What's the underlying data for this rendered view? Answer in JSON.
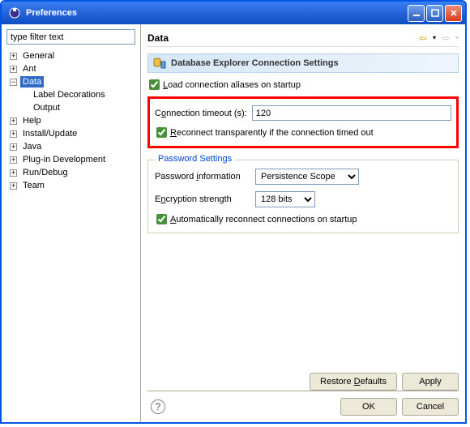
{
  "window": {
    "title": "Preferences"
  },
  "sidebar": {
    "filter_placeholder": "type filter text",
    "items": [
      {
        "label": "General",
        "expandable": true,
        "expanded": false
      },
      {
        "label": "Ant",
        "expandable": true,
        "expanded": false
      },
      {
        "label": "Data",
        "expandable": true,
        "expanded": true,
        "selected": true,
        "children": [
          {
            "label": "Label Decorations"
          },
          {
            "label": "Output"
          }
        ]
      },
      {
        "label": "Help",
        "expandable": true,
        "expanded": false
      },
      {
        "label": "Install/Update",
        "expandable": true,
        "expanded": false
      },
      {
        "label": "Java",
        "expandable": true,
        "expanded": false
      },
      {
        "label": "Plug-in Development",
        "expandable": true,
        "expanded": false
      },
      {
        "label": "Run/Debug",
        "expandable": true,
        "expanded": false
      },
      {
        "label": "Team",
        "expandable": true,
        "expanded": false
      }
    ]
  },
  "main": {
    "title": "Data",
    "banner": "Database Explorer Connection Settings",
    "load_aliases_label": "Load connection aliases on startup",
    "load_aliases_checked": true,
    "timeout_label": "Connection timeout (s):",
    "timeout_value": "120",
    "reconnect_label_pre": "",
    "reconnect_label": "Reconnect transparently if the connection timed out",
    "reconnect_checked": true,
    "password_legend": "Password Settings",
    "password_info_label": "Password information",
    "password_info_value": "Persistence Scope",
    "encryption_label": "Encryption strength",
    "encryption_value": "128 bits",
    "auto_reconnect_label": "Automatically reconnect connections on startup",
    "auto_reconnect_checked": true,
    "restore_defaults": "Restore Defaults",
    "apply": "Apply",
    "ok": "OK",
    "cancel": "Cancel"
  }
}
